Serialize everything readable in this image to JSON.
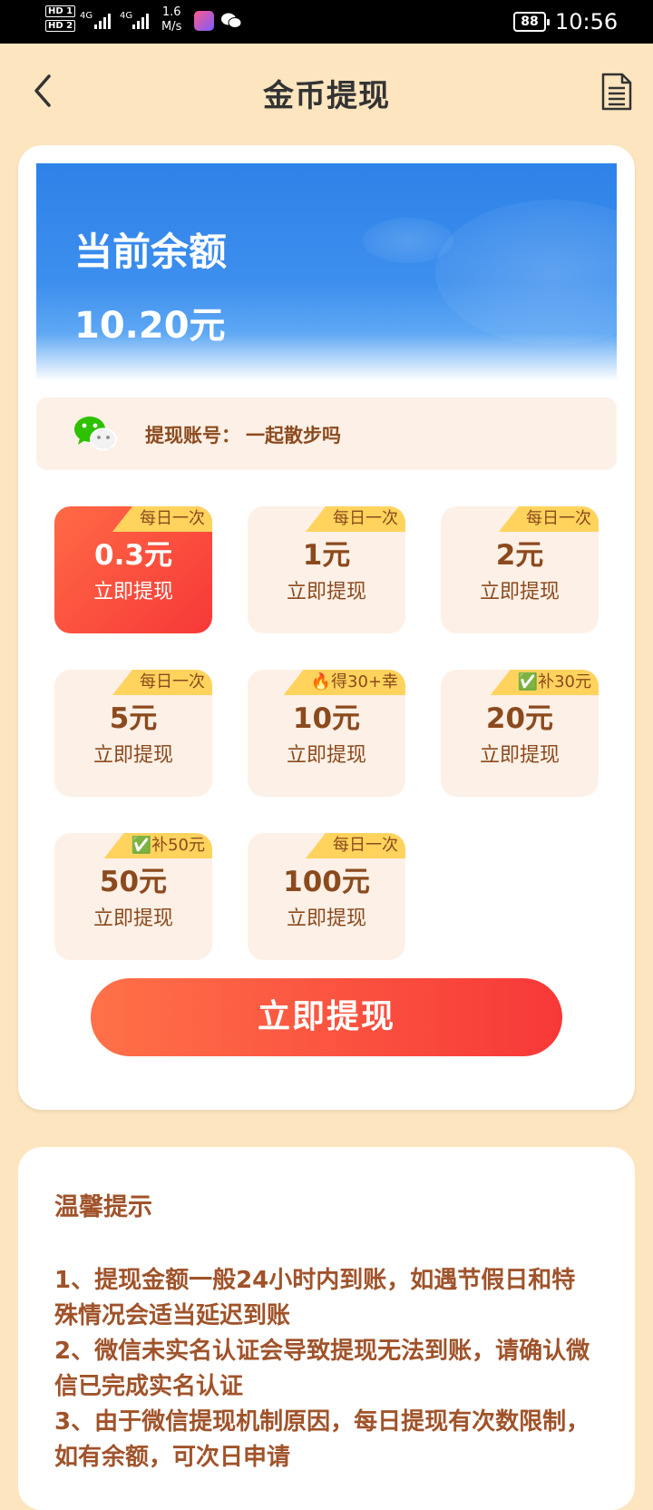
{
  "status_bar": {
    "hd1": "HD 1",
    "hd2": "HD 2",
    "signal1": "4G",
    "signal2": "4G",
    "speed_value": "1.6",
    "speed_unit": "M/s",
    "battery": "88",
    "time": "10:56"
  },
  "header": {
    "title": "金币提现",
    "back_icon": "chevron-left-icon",
    "record_icon": "document-icon"
  },
  "balance": {
    "label": "当前余额",
    "value": "10.20元"
  },
  "account": {
    "icon": "wechat-icon",
    "label": "提现账号：",
    "name": "一起散步吗"
  },
  "amounts": [
    {
      "tag": "每日一次",
      "amount": "0.3元",
      "action": "立即提现",
      "selected": true
    },
    {
      "tag": "每日一次",
      "amount": "1元",
      "action": "立即提现",
      "selected": false
    },
    {
      "tag": "每日一次",
      "amount": "2元",
      "action": "立即提现",
      "selected": false
    },
    {
      "tag": "每日一次",
      "amount": "5元",
      "action": "立即提现",
      "selected": false
    },
    {
      "tag": "🔥得30+幸",
      "amount": "10元",
      "action": "立即提现",
      "selected": false
    },
    {
      "tag": "✅补30元",
      "amount": "20元",
      "action": "立即提现",
      "selected": false
    },
    {
      "tag": "✅补50元",
      "amount": "50元",
      "action": "立即提现",
      "selected": false
    },
    {
      "tag": "每日一次",
      "amount": "100元",
      "action": "立即提现",
      "selected": false
    }
  ],
  "withdraw_button": "立即提现",
  "tips": {
    "title": "温馨提示",
    "items": [
      "1、提现金额一般24小时内到账，如遇节假日和特殊情况会适当延迟到账",
      "2、微信未实名认证会导致提现无法到账，请确认微信已完成实名认证",
      "3、由于微信提现机制原因，每日提现有次数限制，如有余额，可次日申请"
    ]
  },
  "colors": {
    "page_bg": "#FCE5BF",
    "accent_red": "#F73838",
    "accent_orange": "#FF7148",
    "brown_text": "#8B4A1E",
    "tag_yellow": "#FFD35C",
    "banner_blue": "#2E82E8"
  }
}
